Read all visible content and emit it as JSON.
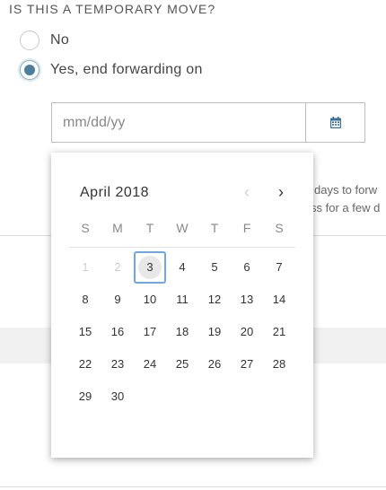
{
  "question": "IS THIS A TEMPORARY MOVE?",
  "options": [
    {
      "label": "No",
      "checked": false
    },
    {
      "label": "Yes, end forwarding on",
      "checked": true
    }
  ],
  "date_input": {
    "placeholder": "mm/dd/yy",
    "value": ""
  },
  "calendar_button_icon": "calendar-icon",
  "background_text": {
    "line1": "days to forw",
    "line2": "ss for a few d"
  },
  "datepicker": {
    "month_label": "April 2018",
    "prev_icon": "‹",
    "next_icon": "›",
    "weekdays": [
      "S",
      "M",
      "T",
      "W",
      "T",
      "F",
      "S"
    ],
    "weeks": [
      [
        "1",
        "2",
        "3",
        "4",
        "5",
        "6",
        "7"
      ],
      [
        "8",
        "9",
        "10",
        "11",
        "12",
        "13",
        "14"
      ],
      [
        "15",
        "16",
        "17",
        "18",
        "19",
        "20",
        "21"
      ],
      [
        "22",
        "23",
        "24",
        "25",
        "26",
        "27",
        "28"
      ],
      [
        "29",
        "30",
        "",
        "",
        "",
        "",
        ""
      ]
    ],
    "disabled_days": [
      "1",
      "2"
    ],
    "today": "3"
  },
  "colors": {
    "accent": "#4a7fa0",
    "today_border": "#6ea6e6",
    "calendar_icon": "#3c6f93"
  }
}
